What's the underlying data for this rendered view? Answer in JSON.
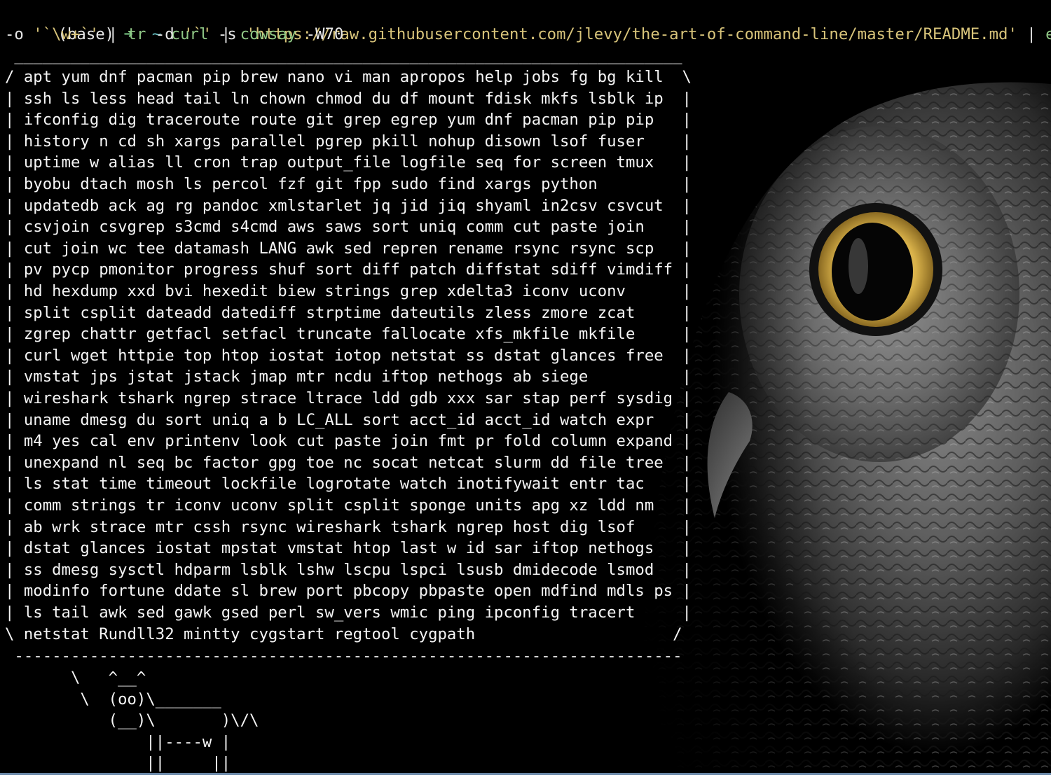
{
  "prompt": {
    "env": "(base)",
    "arrow": "➜",
    "cwd": "~",
    "line1_cmd": "curl",
    "line1_flag": " -s ",
    "line1_url": "'https://raw.githubusercontent.com/jlevy/the-art-of-command-line/master/README.md'",
    "line1_pipe": " | ",
    "line1_cmd2": "egrep",
    "line2_flag": "-o ",
    "line2_pattern": "'`\\w+`'",
    "line2_pipe1": " | ",
    "line2_cmd_tr": "tr",
    "line2_tr_flag": " -d ",
    "line2_tr_arg": "'`'",
    "line2_pipe2": " | ",
    "line2_cmd_cowsay": "cowsay",
    "line2_cowsay_flag": " -W70"
  },
  "bubble": {
    "top_rule": " _______________________________________________________________________",
    "lines": [
      "/ apt yum dnf pacman pip brew nano vi man apropos help jobs fg bg kill  \\",
      "| ssh ls less head tail ln chown chmod du df mount fdisk mkfs lsblk ip  |",
      "| ifconfig dig traceroute route git grep egrep yum dnf pacman pip pip   |",
      "| history n cd sh xargs parallel pgrep pkill nohup disown lsof fuser    |",
      "| uptime w alias ll cron trap output_file logfile seq for screen tmux   |",
      "| byobu dtach mosh ls percol fzf git fpp sudo find xargs python         |",
      "| updatedb ack ag rg pandoc xmlstarlet jq jid jiq shyaml in2csv csvcut  |",
      "| csvjoin csvgrep s3cmd s4cmd aws saws sort uniq comm cut paste join    |",
      "| cut join wc tee datamash LANG awk sed repren rename rsync rsync scp   |",
      "| pv pycp pmonitor progress shuf sort diff patch diffstat sdiff vimdiff |",
      "| hd hexdump xxd bvi hexedit biew strings grep xdelta3 iconv uconv      |",
      "| split csplit dateadd datediff strptime dateutils zless zmore zcat     |",
      "| zgrep chattr getfacl setfacl truncate fallocate xfs_mkfile mkfile     |",
      "| curl wget httpie top htop iostat iotop netstat ss dstat glances free  |",
      "| vmstat jps jstat jstack jmap mtr ncdu iftop nethogs ab siege          |",
      "| wireshark tshark ngrep strace ltrace ldd gdb xxx sar stap perf sysdig |",
      "| uname dmesg du sort uniq a b LC_ALL sort acct_id acct_id watch expr   |",
      "| m4 yes cal env printenv look cut paste join fmt pr fold column expand |",
      "| unexpand nl seq bc factor gpg toe nc socat netcat slurm dd file tree  |",
      "| ls stat time timeout lockfile logrotate watch inotifywait entr tac    |",
      "| comm strings tr iconv uconv split csplit sponge units apg xz ldd nm   |",
      "| ab wrk strace mtr cssh rsync wireshark tshark ngrep host dig lsof     |",
      "| dstat glances iostat mpstat vmstat htop last w id sar iftop nethogs   |",
      "| ss dmesg sysctl hdparm lsblk lshw lscpu lspci lsusb dmidecode lsmod   |",
      "| modinfo fortune ddate sl brew port pbcopy pbpaste open mdfind mdls ps |",
      "| ls tail awk sed gawk gsed perl sw_vers wmic ping ipconfig tracert     |",
      "\\ netstat Rundll32 mintty cygstart regtool cygpath                     /"
    ],
    "bottom_rule": " -----------------------------------------------------------------------"
  },
  "cow": [
    "       \\   ^__^",
    "        \\  (oo)\\_______",
    "           (__)\\       )\\/\\",
    "               ||----w |",
    "               ||     ||"
  ],
  "colors": {
    "background": "#000000",
    "text": "#f2f2f2",
    "command": "#8fc785",
    "string": "#d8c47a",
    "arrow": "#7fd18a",
    "tilde": "#69c4c8"
  }
}
